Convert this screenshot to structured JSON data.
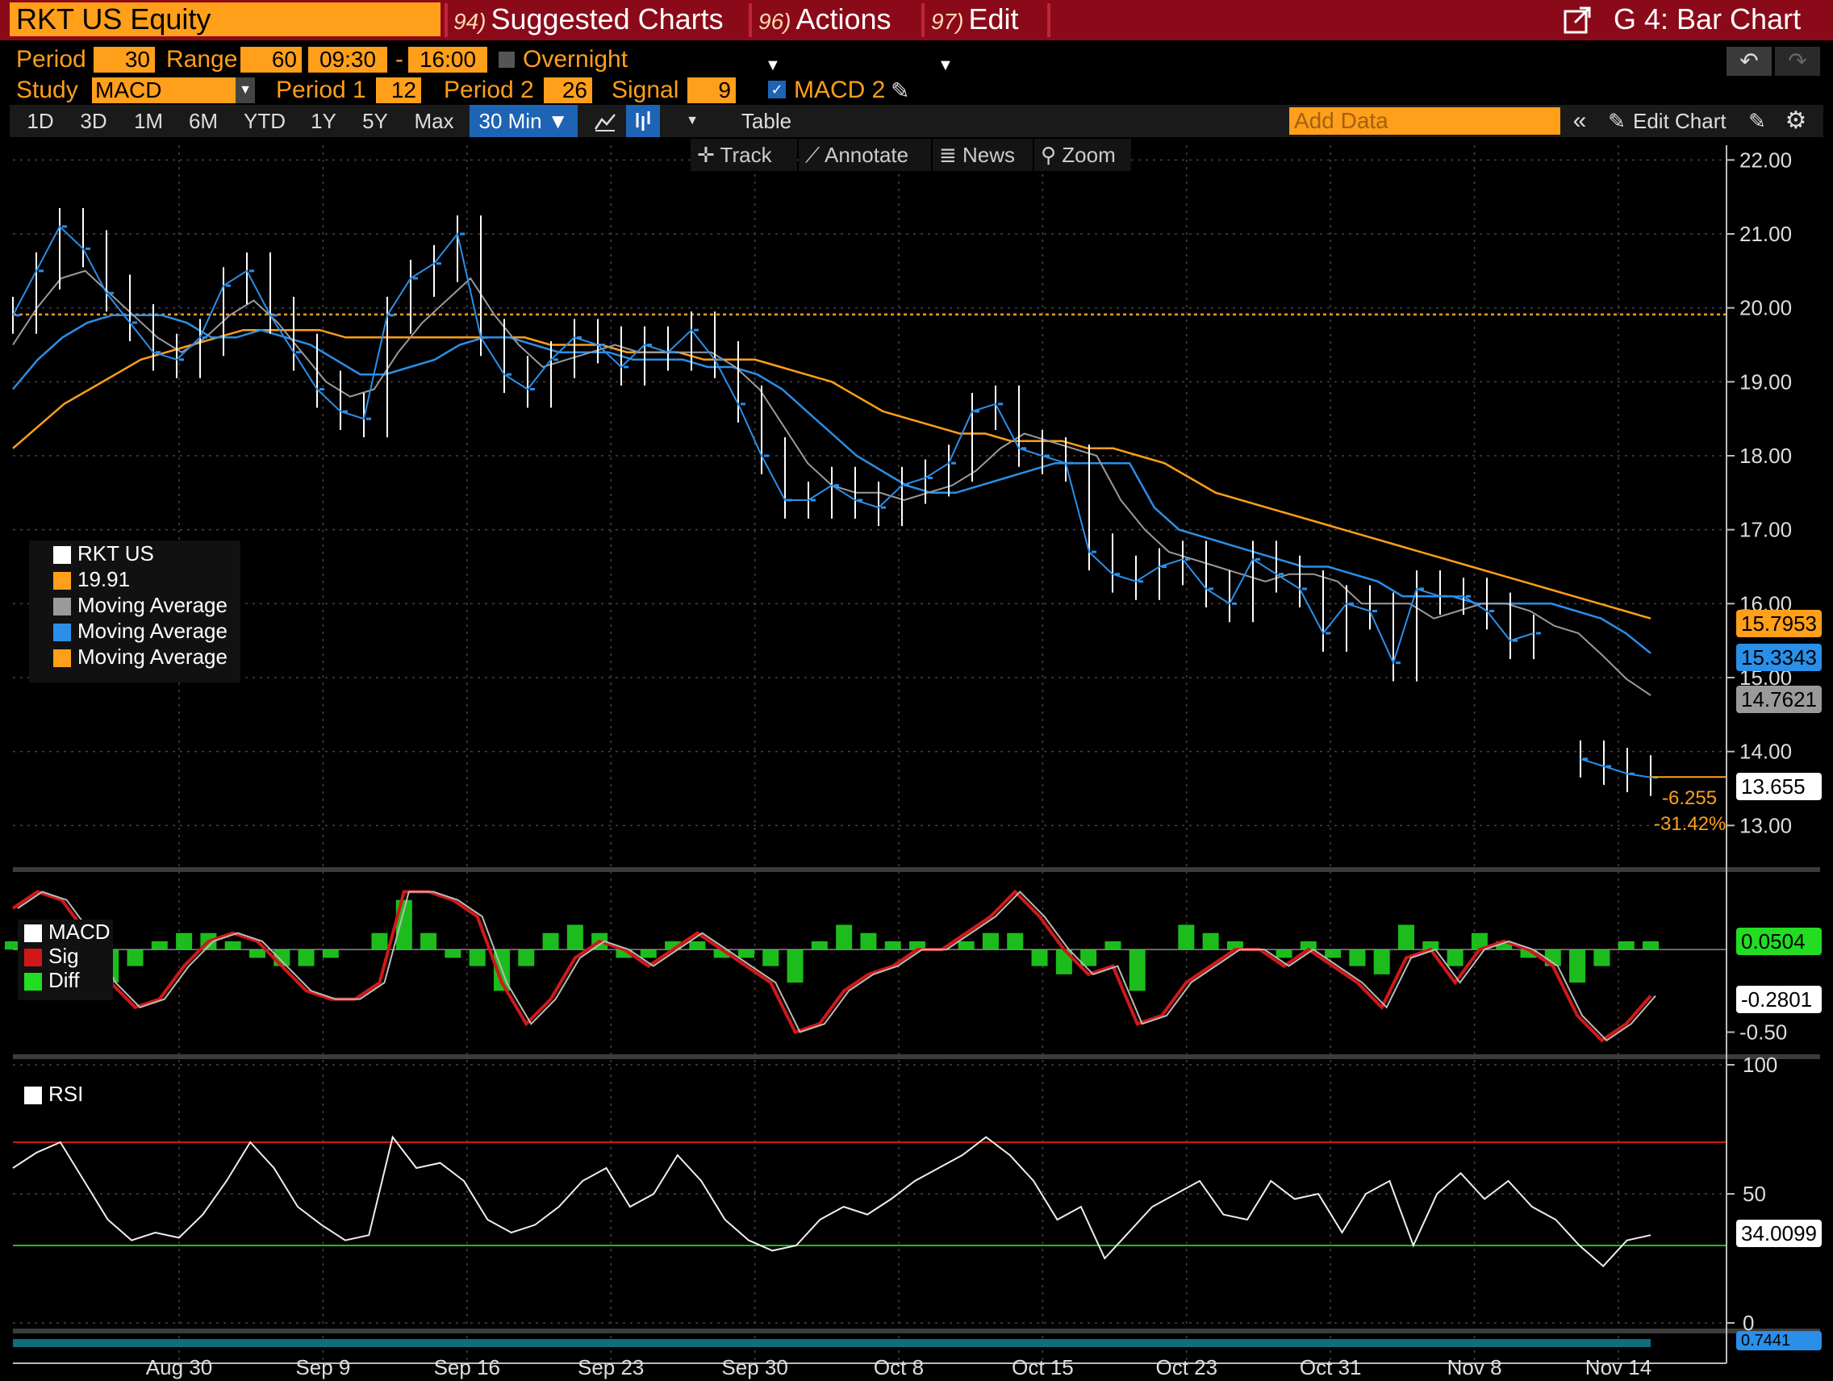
{
  "header": {
    "ticker": "RKT US Equity",
    "menu1_num": "94)",
    "menu1": "Suggested Charts",
    "menu2_num": "96)",
    "menu2": "Actions",
    "menu3_num": "97)",
    "menu3": "Edit",
    "title": "G 4: Bar Chart"
  },
  "params": {
    "period_label": "Period",
    "period": "30",
    "range_label": "Range",
    "range": "60",
    "start": "09:30",
    "dash": "-",
    "end": "16:00",
    "overnight": "Overnight",
    "study_label": "Study",
    "study": "MACD",
    "p1_label": "Period 1",
    "p1": "12",
    "p2_label": "Period 2",
    "p2": "26",
    "signal_label": "Signal",
    "signal": "9",
    "macd2": "MACD 2"
  },
  "toolbar": {
    "ranges": [
      "1D",
      "3D",
      "1M",
      "6M",
      "YTD",
      "1Y",
      "5Y",
      "Max"
    ],
    "interval": "30 Min ▼",
    "table": "Table",
    "add_data_placeholder": "Add Data",
    "edit_chart": "Edit Chart"
  },
  "tools": {
    "track": "Track",
    "annotate": "Annotate",
    "news": "News",
    "zoom": "Zoom"
  },
  "legend": {
    "ticker": "RKT US",
    "last": "19.91",
    "ma1": "Moving Average",
    "ma2": "Moving Average",
    "ma3": "Moving Average"
  },
  "price_axis": [
    "22.00",
    "21.00",
    "20.00",
    "19.00",
    "18.00",
    "17.00",
    "16.00",
    "15.00",
    "14.00",
    "13.00"
  ],
  "price_tags": {
    "ma_orange": "15.7953",
    "ma_blue": "15.3343",
    "ma_gray": "14.7621",
    "last": "13.655",
    "chg": "-6.255",
    "chg_pct": "-31.42%"
  },
  "macd": {
    "legend": [
      "MACD",
      "Sig",
      "Diff"
    ],
    "diff_tag": "0.0504",
    "macd_tag": "-0.2801",
    "axis": "-0.50"
  },
  "rsi": {
    "legend": "RSI",
    "axis": [
      "100",
      "50",
      "0"
    ],
    "tag": "34.0099"
  },
  "bottom_tag": "0.7441",
  "x_axis": [
    "Aug 30",
    "Sep 9",
    "Sep 16",
    "Sep 23",
    "Sep 30",
    "Oct 8",
    "Oct 15",
    "Oct 23",
    "Oct 31",
    "Nov 8",
    "Nov 14"
  ],
  "colors": {
    "orange": "#ff9f1a",
    "blue": "#2a8fe8",
    "gray": "#9a9a9a",
    "macd_sig": "#d01818",
    "diff": "#22dd22",
    "rsi_hi": "#d01818",
    "rsi_lo": "#22bb22"
  },
  "chart_data": {
    "type": "line",
    "price": {
      "ylim": [
        12.6,
        22.2
      ],
      "reference_line": 19.91,
      "close": [
        19.9,
        20.5,
        21.1,
        20.8,
        20.2,
        19.8,
        19.4,
        19.3,
        19.6,
        20.3,
        20.5,
        19.9,
        19.4,
        18.9,
        18.6,
        18.5,
        19.9,
        20.4,
        20.6,
        21.0,
        19.6,
        19.1,
        18.9,
        19.3,
        19.6,
        19.5,
        19.2,
        19.5,
        19.4,
        19.7,
        19.3,
        18.7,
        18.0,
        17.4,
        17.4,
        17.6,
        17.4,
        17.3,
        17.6,
        17.7,
        17.9,
        18.6,
        18.7,
        18.1,
        18.0,
        17.9,
        16.7,
        16.4,
        16.3,
        16.5,
        16.6,
        16.2,
        16.0,
        16.6,
        16.4,
        16.2,
        15.6,
        16.0,
        15.9,
        15.2,
        16.2,
        16.1,
        16.1,
        15.9,
        15.5,
        15.6,
        null,
        13.9,
        13.8,
        13.7,
        13.65
      ],
      "ma_gray": [
        19.5,
        20.0,
        20.4,
        20.5,
        20.2,
        19.9,
        19.6,
        19.4,
        19.6,
        19.9,
        20.1,
        19.8,
        19.4,
        19.0,
        18.8,
        18.9,
        19.4,
        19.8,
        20.1,
        20.4,
        19.9,
        19.5,
        19.2,
        19.3,
        19.4,
        19.5,
        19.4,
        19.4,
        19.4,
        19.4,
        19.2,
        18.9,
        18.4,
        17.9,
        17.6,
        17.5,
        17.5,
        17.4,
        17.5,
        17.6,
        17.8,
        18.1,
        18.3,
        18.2,
        18.1,
        18.0,
        17.4,
        17.0,
        16.7,
        16.6,
        16.5,
        16.4,
        16.3,
        16.4,
        16.4,
        16.3,
        16.0,
        16.0,
        16.0,
        15.8,
        15.9,
        16.0,
        16.0,
        15.9,
        15.7,
        15.6,
        15.3,
        14.98,
        14.76
      ],
      "ma_blue": [
        18.9,
        19.3,
        19.6,
        19.8,
        19.9,
        19.9,
        19.9,
        19.8,
        19.6,
        19.6,
        19.7,
        19.6,
        19.5,
        19.3,
        19.1,
        19.1,
        19.2,
        19.3,
        19.5,
        19.6,
        19.6,
        19.5,
        19.4,
        19.4,
        19.4,
        19.3,
        19.3,
        19.3,
        19.2,
        19.2,
        19.1,
        18.9,
        18.6,
        18.3,
        18.0,
        17.8,
        17.6,
        17.5,
        17.5,
        17.6,
        17.7,
        17.8,
        17.9,
        17.9,
        17.9,
        17.9,
        17.3,
        17.0,
        16.9,
        16.8,
        16.7,
        16.6,
        16.5,
        16.5,
        16.4,
        16.3,
        16.1,
        16.1,
        16.1,
        16.0,
        16.0,
        16.0,
        16.0,
        15.9,
        15.8,
        15.6,
        15.33
      ],
      "ma_orange": [
        18.1,
        18.4,
        18.7,
        18.9,
        19.1,
        19.3,
        19.4,
        19.5,
        19.6,
        19.7,
        19.7,
        19.7,
        19.7,
        19.6,
        19.6,
        19.6,
        19.6,
        19.6,
        19.6,
        19.6,
        19.6,
        19.5,
        19.5,
        19.5,
        19.4,
        19.4,
        19.4,
        19.3,
        19.3,
        19.3,
        19.2,
        19.1,
        19.0,
        18.8,
        18.6,
        18.5,
        18.4,
        18.3,
        18.3,
        18.2,
        18.2,
        18.2,
        18.1,
        18.1,
        18.0,
        17.9,
        17.7,
        17.5,
        17.4,
        17.3,
        17.2,
        17.1,
        17.0,
        16.9,
        16.8,
        16.7,
        16.6,
        16.5,
        16.4,
        16.3,
        16.2,
        16.1,
        16.0,
        15.9,
        15.8
      ]
    },
    "macd": {
      "ylim": [
        -0.6,
        0.45
      ],
      "macd": [
        0.25,
        0.35,
        0.3,
        0.1,
        -0.2,
        -0.35,
        -0.3,
        -0.1,
        0.05,
        0.1,
        0.05,
        -0.1,
        -0.25,
        -0.3,
        -0.3,
        -0.2,
        0.35,
        0.35,
        0.3,
        0.2,
        -0.2,
        -0.45,
        -0.3,
        -0.05,
        0.05,
        0.0,
        -0.1,
        0.0,
        0.1,
        0.0,
        -0.1,
        -0.2,
        -0.5,
        -0.45,
        -0.25,
        -0.15,
        -0.1,
        0.0,
        0.0,
        0.1,
        0.2,
        0.35,
        0.2,
        0.0,
        -0.15,
        -0.1,
        -0.45,
        -0.4,
        -0.2,
        -0.1,
        0.0,
        0.0,
        -0.1,
        0.0,
        -0.1,
        -0.2,
        -0.35,
        -0.05,
        0.0,
        -0.2,
        0.0,
        0.05,
        0.0,
        -0.1,
        -0.4,
        -0.55,
        -0.45,
        -0.28
      ],
      "diff": [
        0.05,
        0.1,
        -0.05,
        -0.15,
        -0.2,
        -0.1,
        0.05,
        0.1,
        0.1,
        0.05,
        -0.05,
        -0.1,
        -0.1,
        -0.05,
        0.0,
        0.1,
        0.3,
        0.1,
        -0.05,
        -0.1,
        -0.25,
        -0.1,
        0.1,
        0.15,
        0.1,
        -0.05,
        -0.05,
        0.05,
        0.05,
        -0.05,
        -0.05,
        -0.1,
        -0.2,
        0.05,
        0.15,
        0.1,
        0.05,
        0.05,
        0.0,
        0.05,
        0.1,
        0.1,
        -0.1,
        -0.15,
        -0.1,
        0.05,
        -0.25,
        0.0,
        0.15,
        0.1,
        0.05,
        0.0,
        -0.05,
        0.05,
        -0.05,
        -0.1,
        -0.15,
        0.15,
        0.05,
        -0.1,
        0.1,
        0.05,
        -0.05,
        -0.1,
        -0.2,
        -0.1,
        0.05,
        0.05
      ]
    },
    "rsi": {
      "ylim": [
        0,
        100
      ],
      "upper_band": 70,
      "lower_band": 30,
      "values": [
        60,
        66,
        70,
        55,
        40,
        32,
        35,
        33,
        42,
        55,
        70,
        60,
        45,
        38,
        32,
        34,
        72,
        60,
        62,
        55,
        40,
        35,
        38,
        45,
        55,
        60,
        45,
        50,
        65,
        55,
        40,
        32,
        28,
        30,
        40,
        45,
        42,
        48,
        55,
        60,
        65,
        72,
        65,
        55,
        40,
        45,
        25,
        35,
        45,
        50,
        55,
        42,
        40,
        55,
        48,
        50,
        35,
        50,
        55,
        30,
        50,
        58,
        48,
        55,
        45,
        40,
        30,
        22,
        32,
        34
      ]
    },
    "x_labels": [
      "Aug 30",
      "Sep 9",
      "Sep 16",
      "Sep 23",
      "Sep 30",
      "Oct 8",
      "Oct 15",
      "Oct 23",
      "Oct 31",
      "Nov 8",
      "Nov 14"
    ]
  }
}
